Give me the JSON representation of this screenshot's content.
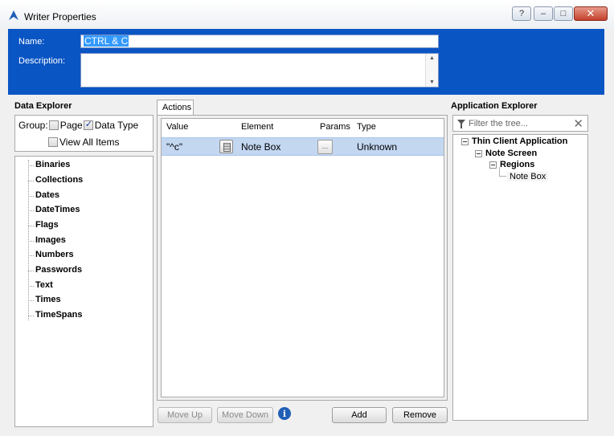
{
  "window": {
    "title": "Writer Properties",
    "help_label": "?",
    "minimize_label": "–",
    "maximize_label": "□",
    "close_label": "✕"
  },
  "form": {
    "name_label": "Name:",
    "name_value": "CTRL & C",
    "description_label": "Description:",
    "description_value": ""
  },
  "data_explorer": {
    "title": "Data Explorer",
    "group_label": "Group:",
    "page_label": "Page",
    "page_checked": false,
    "data_type_label": "Data Type",
    "data_type_checked": true,
    "view_all_label": "View All Items",
    "view_all_checked": false,
    "items": [
      "Binaries",
      "Collections",
      "Dates",
      "DateTimes",
      "Flags",
      "Images",
      "Numbers",
      "Passwords",
      "Text",
      "Times",
      "TimeSpans"
    ]
  },
  "actions": {
    "tab_label": "Actions",
    "columns": {
      "value": "Value",
      "element": "Element",
      "params": "Params",
      "type": "Type"
    },
    "rows": [
      {
        "value": "\"^c\"",
        "element": "Note Box",
        "params_label": "...",
        "type": "Unknown"
      }
    ],
    "move_up_label": "Move Up",
    "move_down_label": "Move Down",
    "info_label": "i",
    "add_label": "Add",
    "remove_label": "Remove"
  },
  "application_explorer": {
    "title": "Application Explorer",
    "filter_placeholder": "Filter the tree...",
    "clear_label": "✕",
    "tree": {
      "root": "Thin Client Application",
      "screen": "Note Screen",
      "regions": "Regions",
      "leaf": "Note Box"
    }
  },
  "colors": {
    "header_blue": "#0a55c4",
    "selection_blue": "#3399ff",
    "row_highlight": "#c3d7f1"
  }
}
